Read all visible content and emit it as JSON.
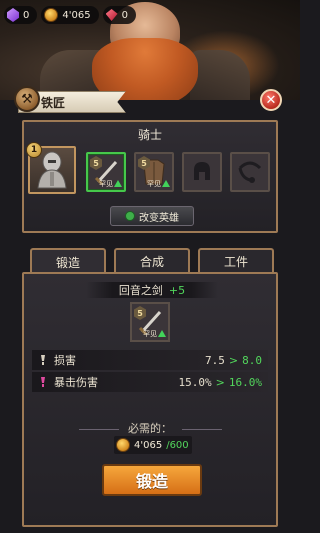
{
  "currency": {
    "purple": "0",
    "gold": "4'065",
    "red": "0"
  },
  "title": "铁匠",
  "hero": {
    "name": "骑士",
    "level": "1",
    "change_label": "改变英雄"
  },
  "equipment_slots": [
    {
      "tier": "5",
      "rarity": "罕见",
      "icon": "sword-icon",
      "selected": true,
      "upgradeable": true
    },
    {
      "tier": "5",
      "rarity": "罕见",
      "icon": "armor-icon",
      "selected": false,
      "upgradeable": true
    },
    {
      "tier": "",
      "rarity": "",
      "icon": "helmet-icon",
      "selected": false,
      "upgradeable": false
    },
    {
      "tier": "",
      "rarity": "",
      "icon": "amulet-icon",
      "selected": false,
      "upgradeable": false
    }
  ],
  "tabs": [
    "锻造",
    "合成",
    "工件"
  ],
  "active_tab": 0,
  "item": {
    "name": "回音之剑",
    "plus": "+5",
    "tier": "5",
    "rarity": "罕见"
  },
  "stats": [
    {
      "label": "损害",
      "current": "7.5",
      "next": "8.0",
      "icon_color": "#d8d0c0"
    },
    {
      "label": "暴击伤害",
      "current": "15.0%",
      "next": "16.0%",
      "icon_color": "#e04aa0"
    }
  ],
  "required_label": "必需的：",
  "cost": {
    "have": "4'065",
    "need": "/600"
  },
  "forge_button": "锻造",
  "colors": {
    "accent_green": "#52d65c",
    "frame": "#9e7a55",
    "button_orange": "#e8891f"
  }
}
